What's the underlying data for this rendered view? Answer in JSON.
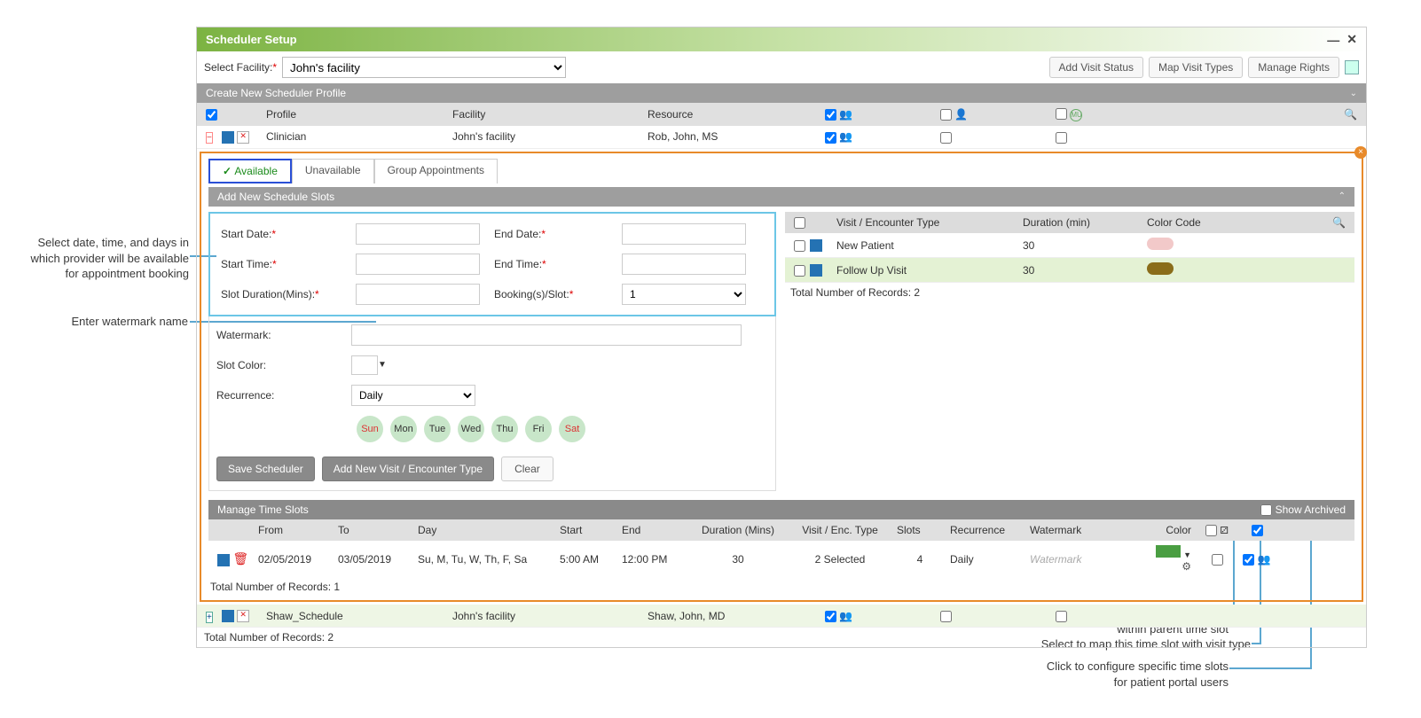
{
  "header": {
    "title": "Scheduler Setup"
  },
  "facility": {
    "label": "Select Facility:",
    "value": "John's facility"
  },
  "topButtons": {
    "addVisitStatus": "Add Visit Status",
    "mapVisitTypes": "Map Visit Types",
    "manageRights": "Manage Rights"
  },
  "section1": {
    "title": "Create New Scheduler Profile"
  },
  "profileHeader": {
    "profile": "Profile",
    "facility": "Facility",
    "resource": "Resource"
  },
  "profiles": [
    {
      "name": "Clinician",
      "facility": "John's facility",
      "resource": "Rob, John, MS"
    },
    {
      "name": "Shaw_Schedule",
      "facility": "John's facility",
      "resource": "Shaw, John, MD"
    }
  ],
  "tabs": {
    "available": "Available",
    "unavailable": "Unavailable",
    "group": "Group Appointments"
  },
  "addSlots": {
    "title": "Add New Schedule Slots",
    "startDate": "Start Date:",
    "endDate": "End Date:",
    "startTime": "Start Time:",
    "endTime": "End Time:",
    "slotDuration": "Slot Duration(Mins):",
    "bookingsPerSlot": "Booking(s)/Slot:",
    "bookingsValue": "1",
    "watermark": "Watermark:",
    "slotColor": "Slot Color:",
    "recurrence": "Recurrence:",
    "recurrenceValue": "Daily"
  },
  "days": {
    "sun": "Sun",
    "mon": "Mon",
    "tue": "Tue",
    "wed": "Wed",
    "thu": "Thu",
    "fri": "Fri",
    "sat": "Sat"
  },
  "buttons": {
    "save": "Save Scheduler",
    "addVisit": "Add New Visit / Encounter Type",
    "clear": "Clear"
  },
  "visitTable": {
    "head": {
      "type": "Visit / Encounter Type",
      "duration": "Duration (min)",
      "color": "Color Code"
    },
    "rows": [
      {
        "type": "New Patient",
        "duration": "30",
        "color": "#f2c9c9"
      },
      {
        "type": "Follow Up Visit",
        "duration": "30",
        "color": "#8a6d1a"
      }
    ],
    "total": "Total Number of Records: 2"
  },
  "mts": {
    "title": "Manage Time Slots",
    "showArchived": "Show Archived",
    "head": {
      "from": "From",
      "to": "To",
      "day": "Day",
      "start": "Start",
      "end": "End",
      "duration": "Duration (Mins)",
      "visit": "Visit / Enc. Type",
      "slots": "Slots",
      "recurrence": "Recurrence",
      "watermark": "Watermark",
      "color": "Color"
    },
    "row": {
      "from": "02/05/2019",
      "to": "03/05/2019",
      "day": "Su, M, Tu, W, Th, F, Sa",
      "start": "5:00 AM",
      "end": "12:00 PM",
      "duration": "30",
      "visit": "2 Selected",
      "slots": "4",
      "recurrence": "Daily",
      "watermark": "Watermark"
    },
    "total": "Total Number of Records: 1"
  },
  "footer": {
    "total": "Total Number of Records: 2"
  },
  "annotations": {
    "a1": "Select date, time, and days in which provider will be available for appointment booking",
    "a2": "Enter watermark name",
    "a3": "Click to configure addtional time slots within parent time slot",
    "a4": "Select to map this time slot with visit type",
    "a5": "Click to configure specific time slots for patient portal users"
  }
}
